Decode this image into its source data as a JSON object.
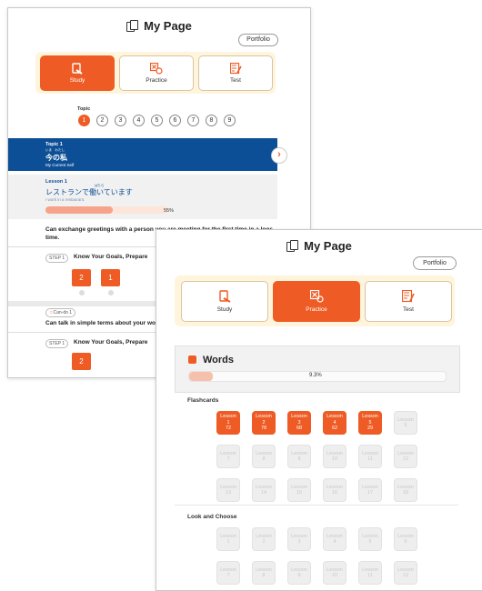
{
  "colors": {
    "accent": "#ee5b24",
    "topic_header": "#0d4f96",
    "tab_bar": "#fff4dc"
  },
  "panel1": {
    "title": "My Page",
    "portfolio": "Portfolio",
    "tabs": [
      {
        "label": "Study",
        "icon": "study-icon"
      },
      {
        "label": "Practice",
        "icon": "practice-icon"
      },
      {
        "label": "Test",
        "icon": "test-icon"
      }
    ],
    "topic_label": "Topic",
    "topic_numbers": [
      "1",
      "2",
      "3",
      "4",
      "5",
      "6",
      "7",
      "8",
      "9"
    ],
    "topic": {
      "label": "Topic 1",
      "ruby": "いま　わたし",
      "title_jp": "今の私",
      "subtitle": "My Current Self"
    },
    "lesson": {
      "label": "Lesson 1",
      "ruby": "はたら",
      "title_jp": "レストランで働いています",
      "subtitle": "I work in a restaurant.",
      "progress_text": "55%",
      "progress": 0.55
    },
    "can_do_1": "Can exchange greetings with a person you are meeting for the first time in a loos time.",
    "step": {
      "badge": "STEP 1",
      "title": "Know Your Goals, Prepare",
      "boxes": [
        "2",
        "1"
      ]
    },
    "can_do_badge": "Can-do 1",
    "can_do_2": "Can talk in simple terms about your work",
    "step2": {
      "badge": "STEP 1",
      "title": "Know Your Goals, Prepare",
      "box": "2"
    }
  },
  "panel2": {
    "title": "My Page",
    "portfolio": "Portfolio",
    "tabs": [
      {
        "label": "Study",
        "icon": "study-icon"
      },
      {
        "label": "Practice",
        "icon": "practice-icon"
      },
      {
        "label": "Test",
        "icon": "test-icon"
      }
    ],
    "words": {
      "title": "Words",
      "progress_text": "9.3%",
      "progress": 0.093
    },
    "flashcards": {
      "label": "Flashcards",
      "tiles": [
        {
          "l1": "Lesson",
          "l2": "1",
          "l3": "72",
          "done": true
        },
        {
          "l1": "Lesson",
          "l2": "2",
          "l3": "78",
          "done": true
        },
        {
          "l1": "Lesson",
          "l2": "3",
          "l3": "68",
          "done": true
        },
        {
          "l1": "Lesson",
          "l2": "4",
          "l3": "62",
          "done": true
        },
        {
          "l1": "Lesson",
          "l2": "5",
          "l3": "29",
          "done": true
        },
        {
          "l1": "Lesson",
          "l2": "6",
          "l3": "",
          "done": false
        },
        {
          "l1": "Lesson",
          "l2": "7",
          "l3": "",
          "done": false
        },
        {
          "l1": "Lesson",
          "l2": "8",
          "l3": "",
          "done": false
        },
        {
          "l1": "Lesson",
          "l2": "9",
          "l3": "",
          "done": false
        },
        {
          "l1": "Lesson",
          "l2": "10",
          "l3": "",
          "done": false
        },
        {
          "l1": "Lesson",
          "l2": "11",
          "l3": "",
          "done": false
        },
        {
          "l1": "Lesson",
          "l2": "12",
          "l3": "",
          "done": false
        },
        {
          "l1": "Lesson",
          "l2": "13",
          "l3": "",
          "done": false
        },
        {
          "l1": "Lesson",
          "l2": "14",
          "l3": "",
          "done": false
        },
        {
          "l1": "Lesson",
          "l2": "15",
          "l3": "",
          "done": false
        },
        {
          "l1": "Lesson",
          "l2": "16",
          "l3": "",
          "done": false
        },
        {
          "l1": "Lesson",
          "l2": "17",
          "l3": "",
          "done": false
        },
        {
          "l1": "Lesson",
          "l2": "18",
          "l3": "",
          "done": false
        }
      ]
    },
    "look_and_choose": {
      "label": "Look and Choose",
      "tiles": [
        {
          "l1": "Lesson",
          "l2": "1"
        },
        {
          "l1": "Lesson",
          "l2": "2"
        },
        {
          "l1": "Lesson",
          "l2": "3"
        },
        {
          "l1": "Lesson",
          "l2": "4"
        },
        {
          "l1": "Lesson",
          "l2": "5"
        },
        {
          "l1": "Lesson",
          "l2": "6"
        },
        {
          "l1": "Lesson",
          "l2": "7"
        },
        {
          "l1": "Lesson",
          "l2": "8"
        },
        {
          "l1": "Lesson",
          "l2": "9"
        },
        {
          "l1": "Lesson",
          "l2": "10"
        },
        {
          "l1": "Lesson",
          "l2": "11"
        },
        {
          "l1": "Lesson",
          "l2": "12"
        }
      ]
    }
  }
}
